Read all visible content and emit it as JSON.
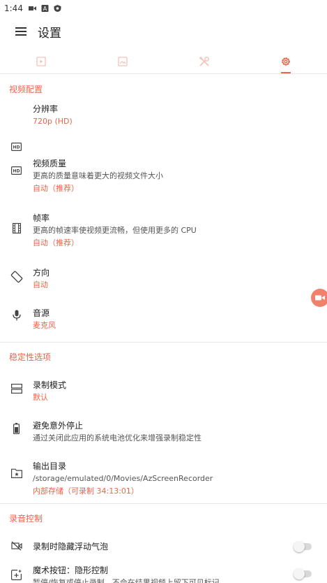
{
  "status_bar": {
    "time": "1:44"
  },
  "app_bar": {
    "title": "设置"
  },
  "colors": {
    "accent": "#e8654a",
    "icon_inactive": "#f4c3b8"
  },
  "tabs": [
    {
      "icon": "video-tab-icon",
      "active": false
    },
    {
      "icon": "image-tab-icon",
      "active": false
    },
    {
      "icon": "tools-tab-icon",
      "active": false
    },
    {
      "icon": "settings-tab-icon",
      "active": true
    }
  ],
  "video_section": {
    "header": "视频配置",
    "resolution": {
      "title": "分辨率",
      "value": "720p (HD)"
    },
    "quality": {
      "title": "视频质量",
      "desc": "更高的质量意味着更大的视频文件大小",
      "value": "自动（推荐）"
    },
    "framerate": {
      "title": "帧率",
      "desc": "更高的帧速率使视频更流畅，但使用更多的 CPU",
      "value": "自动（推荐）"
    },
    "orientation": {
      "title": "方向",
      "value": "自动"
    },
    "audio": {
      "title": "音源",
      "value": "麦克风"
    }
  },
  "stability_section": {
    "header": "稳定性选项",
    "record_mode": {
      "title": "录制模式",
      "value": "默认"
    },
    "battery": {
      "title": "避免意外停止",
      "desc": "通过关闭此应用的系统电池优化来增强录制稳定性"
    },
    "output": {
      "title": "输出目录",
      "desc": "/storage/emulated/0/Movies/AzScreenRecorder",
      "value": "内部存储（可录制 34:13:01）"
    }
  },
  "recording_section": {
    "header": "录音控制",
    "hide_bubble": {
      "title": "录制时隐藏浮动气泡",
      "enabled": false
    },
    "magic_button": {
      "title": "魔术按钮：隐形控制",
      "desc": "暂停/恢复或停止录制，不会在结果视频上留下可见标记",
      "enabled": false
    }
  }
}
